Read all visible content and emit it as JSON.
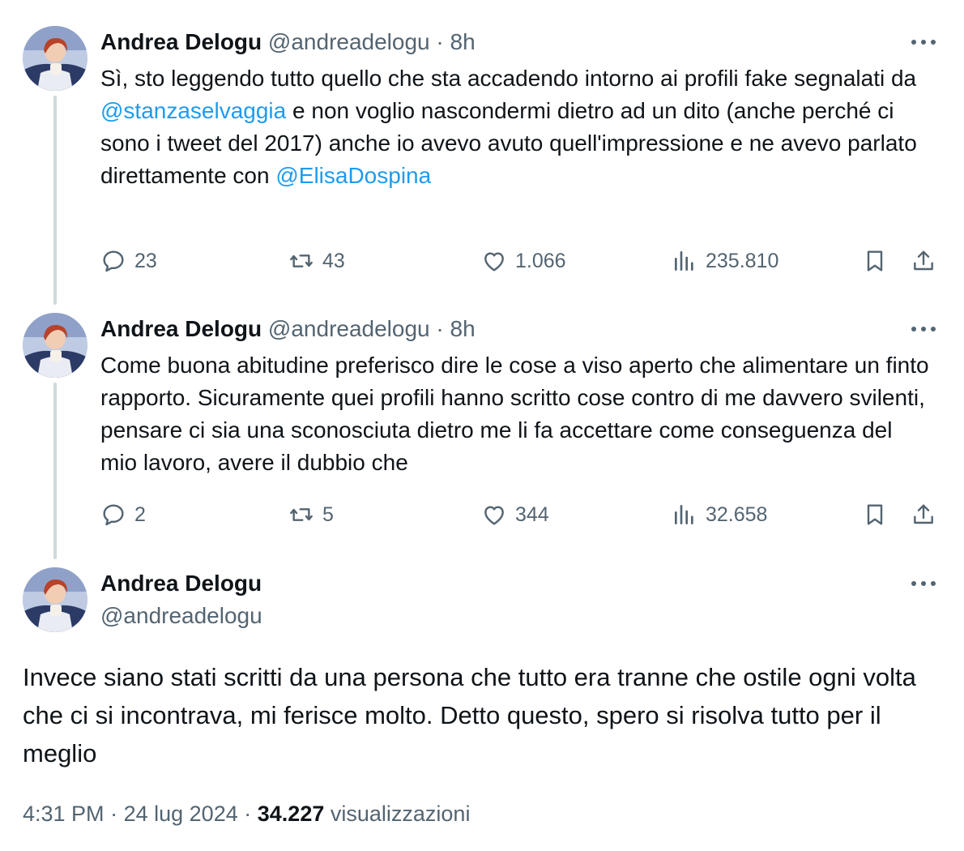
{
  "author": {
    "name": "Andrea Delogu",
    "handle": "@andreadelogu"
  },
  "tweets": [
    {
      "time": "8h",
      "text_parts": [
        "Sì, sto leggendo tutto quello che sta accadendo intorno ai profili fake segnalati da ",
        "@stanzaselvaggia",
        " e non voglio nascondermi dietro ad un dito (anche perché ci sono i tweet del 2017) anche io avevo avuto quell'impressione e ne avevo parlato direttamente con ",
        "@ElisaDospina"
      ],
      "replies": "23",
      "reposts": "43",
      "likes": "1.066",
      "views": "235.810"
    },
    {
      "time": "8h",
      "text": "Come buona abitudine preferisco dire le cose a viso aperto che alimentare un finto rapporto. Sicuramente quei profili hanno scritto cose contro di me davvero svilenti, pensare ci sia una sconosciuta dietro me li fa accettare come conseguenza del mio lavoro, avere il dubbio che",
      "replies": "2",
      "reposts": "5",
      "likes": "344",
      "views": "32.658"
    }
  ],
  "main_tweet": {
    "text": "Invece siano stati scritti da una persona che tutto era tranne che ostile ogni volta che ci si incontrava, mi ferisce molto. Detto questo, spero si risolva tutto per il meglio",
    "time": "4:31 PM",
    "date": "24 lug 2024",
    "views": "34.227",
    "views_label": "visualizzazioni"
  },
  "sep": "·",
  "more_label": "···",
  "colors": {
    "accent": "#1d9bf0",
    "secondary_text": "#536471",
    "thread_line": "#cfd9de"
  },
  "icons": [
    "reply-icon",
    "repost-icon",
    "like-icon",
    "views-icon",
    "bookmark-icon",
    "share-icon",
    "more-icon"
  ]
}
